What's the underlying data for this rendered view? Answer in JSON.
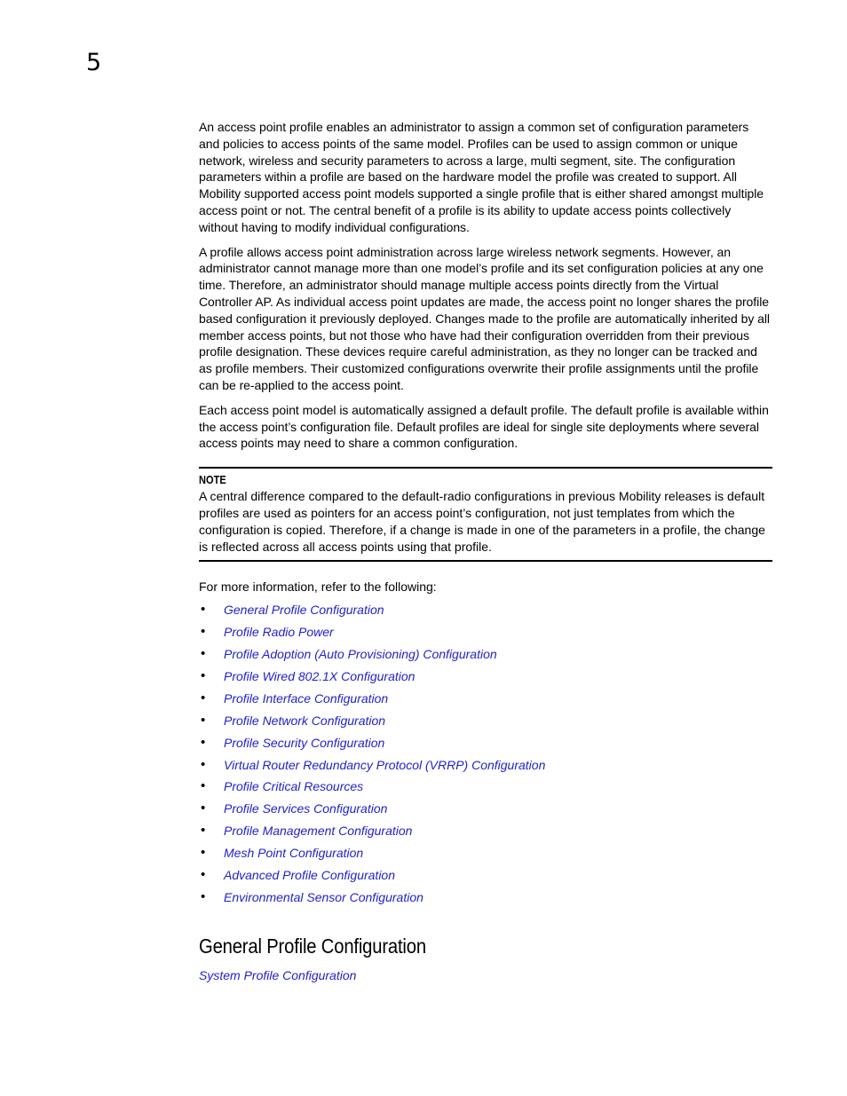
{
  "page": {
    "chapter_number": "5"
  },
  "intro": {
    "paragraphs": [
      "An access point profile enables an administrator to assign a common set of configuration parameters and policies to  access points of the same model. Profiles can be used to assign common or unique network, wireless and security parameters to across a large, multi segment, site. The configuration parameters within a profile are based on the hardware model the profile was created to support. All Mobility supported access point models supported a single profile that is either shared amongst multiple access point or not. The central benefit of a profile is its ability to update access points collectively without having to modify individual configurations.",
      "A profile allows access point administration across large wireless network segments. However, an administrator cannot manage more than one model’s profile and its set configuration policies at any one time. Therefore, an administrator should manage multiple access points directly from the Virtual Controller AP. As individual access point updates are made, the access point no longer shares the profile based configuration it previously deployed. Changes made to the profile are automatically inherited by all member access points, but not those who have had their configuration overridden from their previous profile designation. These devices require careful administration, as they no longer can be tracked and as profile members. Their customized configurations overwrite their profile assignments until the profile can be re-applied to the access point.",
      "Each access point model is automatically assigned a default profile. The default profile is available within the access point’s configuration file. Default profiles are ideal for single site deployments where several access points may need to share a common configuration."
    ]
  },
  "note": {
    "label": "NOTE",
    "text": "A central difference compared to the default-radio configurations in previous Mobility releases is default profiles are used as pointers for an access point’s configuration, not just templates from which the configuration is copied. Therefore, if a change is made in one of the parameters in a profile, the change is reflected across all access points using that profile."
  },
  "references": {
    "intro": "For more information, refer to the following:",
    "bullet_glyph": "•",
    "link_color": "#1f1fcc",
    "links": [
      "General Profile Configuration",
      "Profile Radio Power",
      "Profile Adoption (Auto Provisioning) Configuration",
      "Profile Wired 802.1X Configuration",
      "Profile Interface Configuration",
      "Profile Network Configuration",
      "Profile Security Configuration",
      "Virtual Router Redundancy Protocol (VRRP) Configuration",
      "Profile Critical Resources",
      "Profile Services Configuration",
      "Profile Management Configuration",
      "Mesh Point Configuration",
      "Advanced Profile Configuration",
      "Environmental Sensor Configuration"
    ]
  },
  "section": {
    "heading": "General Profile Configuration",
    "sublink": "System Profile Configuration"
  }
}
